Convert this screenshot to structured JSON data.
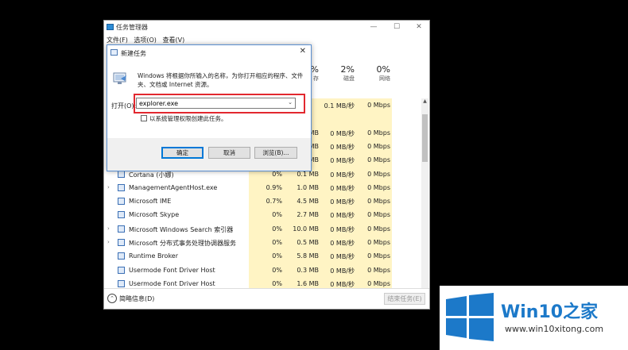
{
  "taskmanager": {
    "title": "任务管理器",
    "menu": [
      "文件(F)",
      "选项(O)",
      "查看(V)"
    ],
    "window_controls": {
      "minimize": "—",
      "maximize": "☐",
      "close": "✕"
    },
    "columns": {
      "mem": {
        "pct": "%",
        "label": "存"
      },
      "disk": {
        "pct": "2%",
        "label": "磁盘"
      },
      "net": {
        "pct": "0%",
        "label": "网络"
      }
    },
    "rows": [
      {
        "name": "",
        "cpu": "",
        "mem": "",
        "disk": "0.1 MB/秒",
        "net": "0 Mbps",
        "expand": false
      },
      {
        "name": "",
        "cpu": "",
        "mem": "",
        "disk": "",
        "net": "",
        "expand": false
      },
      {
        "name": "",
        "cpu": "",
        "mem": "MB",
        "disk": "0 MB/秒",
        "net": "0 Mbps",
        "expand": false
      },
      {
        "name": "",
        "cpu": "",
        "mem": "MB",
        "disk": "0 MB/秒",
        "net": "0 Mbps",
        "expand": false
      },
      {
        "name": "",
        "cpu": "",
        "mem": "MB",
        "disk": "0 MB/秒",
        "net": "0 Mbps",
        "expand": false
      },
      {
        "name": "Cortana (小娜)",
        "cpu": "0%",
        "mem": "0.1 MB",
        "disk": "0 MB/秒",
        "net": "0 Mbps",
        "expand": false
      },
      {
        "name": "ManagementAgentHost.exe",
        "cpu": "0.9%",
        "mem": "1.0 MB",
        "disk": "0 MB/秒",
        "net": "0 Mbps",
        "expand": true
      },
      {
        "name": "Microsoft IME",
        "cpu": "0.7%",
        "mem": "4.5 MB",
        "disk": "0 MB/秒",
        "net": "0 Mbps",
        "expand": false
      },
      {
        "name": "Microsoft Skype",
        "cpu": "0%",
        "mem": "2.7 MB",
        "disk": "0 MB/秒",
        "net": "0 Mbps",
        "expand": false
      },
      {
        "name": "Microsoft Windows Search 索引器",
        "cpu": "0%",
        "mem": "10.0 MB",
        "disk": "0 MB/秒",
        "net": "0 Mbps",
        "expand": true
      },
      {
        "name": "Microsoft 分布式事务处理协调器服务",
        "cpu": "0%",
        "mem": "0.5 MB",
        "disk": "0 MB/秒",
        "net": "0 Mbps",
        "expand": true
      },
      {
        "name": "Runtime Broker",
        "cpu": "0%",
        "mem": "5.8 MB",
        "disk": "0 MB/秒",
        "net": "0 Mbps",
        "expand": false
      },
      {
        "name": "Usermode Font Driver Host",
        "cpu": "0%",
        "mem": "0.3 MB",
        "disk": "0 MB/秒",
        "net": "0 Mbps",
        "expand": false
      },
      {
        "name": "Usermode Font Driver Host",
        "cpu": "0%",
        "mem": "1.6 MB",
        "disk": "0 MB/秒",
        "net": "0 Mbps",
        "expand": false
      }
    ],
    "footer": {
      "fewer_details": "简略信息(D)",
      "end_task": "结束任务(E)"
    }
  },
  "run_dialog": {
    "title": "新建任务",
    "close": "✕",
    "description": "Windows 将根据你所输入的名称，为你打开相应的程序、文件夹、文档或 Internet 资源。",
    "open_label": "打开(O):",
    "input_value": "explorer.exe",
    "admin_checkbox_label": "以系统管理权限创建此任务。",
    "admin_checked": false,
    "buttons": {
      "ok": "确定",
      "cancel": "取消",
      "browse": "浏览(B)..."
    }
  },
  "watermark": {
    "brand_prefix": "Win10",
    "brand_suffix": "之家",
    "url": "www.win10xitong.com"
  }
}
